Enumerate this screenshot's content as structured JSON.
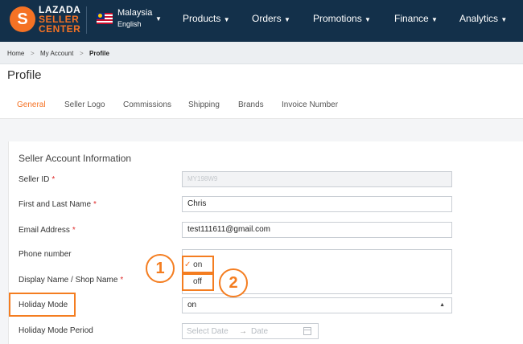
{
  "brand": {
    "logo_mark": "S",
    "line1": "LAZADA",
    "line2": "SELLER",
    "line3": "CENTER"
  },
  "locale": {
    "country": "Malaysia",
    "language": "English",
    "caret": "▼"
  },
  "nav": {
    "items": [
      {
        "label": "Products"
      },
      {
        "label": "Orders"
      },
      {
        "label": "Promotions"
      },
      {
        "label": "Finance"
      },
      {
        "label": "Analytics"
      }
    ],
    "caret": "▼"
  },
  "breadcrumb": {
    "items": [
      "Home",
      "My Account",
      "Profile"
    ],
    "separator": ">"
  },
  "page_title": "Profile",
  "tabs": [
    {
      "label": "General",
      "active": true
    },
    {
      "label": "Seller Logo"
    },
    {
      "label": "Commissions"
    },
    {
      "label": "Shipping"
    },
    {
      "label": "Brands"
    },
    {
      "label": "Invoice Number"
    }
  ],
  "section_title": "Seller Account Information",
  "form": {
    "seller_id": {
      "label": "Seller ID",
      "value": "MY198W9",
      "required_mark": "*"
    },
    "name": {
      "label": "First and Last Name",
      "value": "Chris",
      "required_mark": "*"
    },
    "email": {
      "label": "Email Address",
      "value": "test111611@gmail.com",
      "required_mark": "*"
    },
    "phone": {
      "label": "Phone number"
    },
    "display_name": {
      "label": "Display Name / Shop Name",
      "required_mark": "*"
    },
    "holiday_mode": {
      "label": "Holiday Mode",
      "value": "on",
      "caret": "▲",
      "options": [
        {
          "label": "on",
          "checked": true,
          "check": "✓"
        },
        {
          "label": "off"
        }
      ]
    },
    "holiday_period": {
      "label": "Holiday Mode Period",
      "start_placeholder": "Select Date",
      "arrow": "→",
      "end_placeholder": "Date"
    }
  },
  "annotations": {
    "callout_1": "1",
    "callout_2": "2"
  },
  "colors": {
    "topbar": "#13304a",
    "accent": "#f57224",
    "annotation": "#f47d20",
    "required": "#e02c2c"
  }
}
